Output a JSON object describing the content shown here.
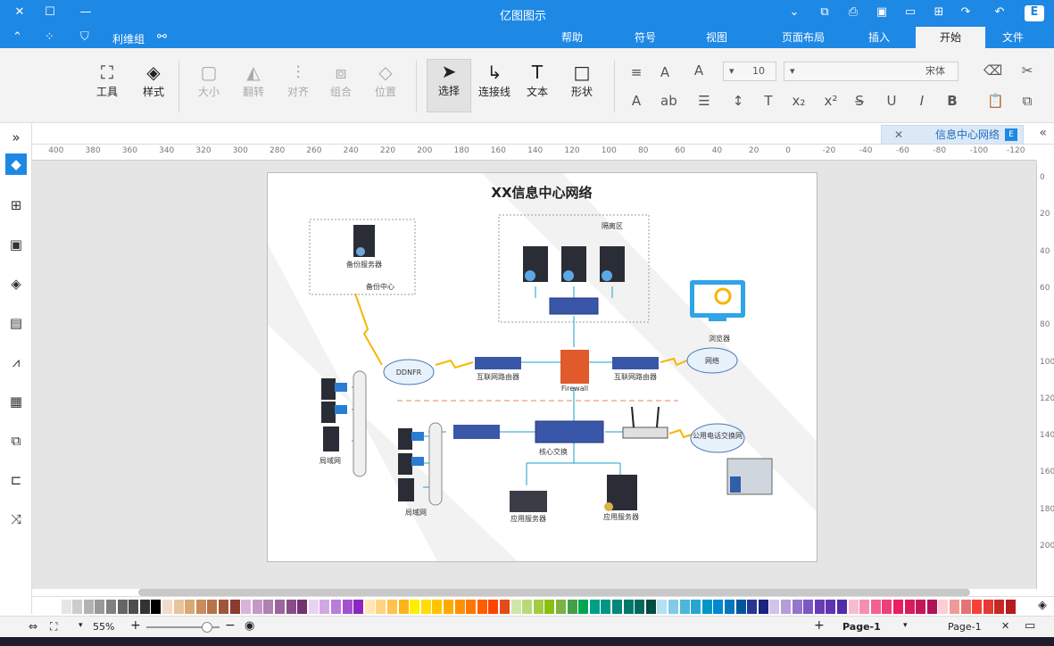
{
  "window": {
    "title": "亿图图示"
  },
  "menu": {
    "tabs": [
      "文件",
      "开始",
      "插入",
      "页面布局",
      "视图",
      "符号",
      "帮助"
    ],
    "active": "开始",
    "quick_items": [
      "利维组"
    ]
  },
  "ribbon": {
    "font_name": "宋体",
    "font_size": "10",
    "tools": [
      {
        "label": "形状",
        "icon": "shape-icon"
      },
      {
        "label": "文本",
        "icon": "text-icon"
      },
      {
        "label": "连接线",
        "icon": "connector-icon"
      },
      {
        "label": "选择",
        "icon": "select-icon"
      },
      {
        "label": "位置",
        "icon": "position-icon"
      },
      {
        "label": "组合",
        "icon": "group-icon"
      },
      {
        "label": "对齐",
        "icon": "align-icon"
      },
      {
        "label": "翻转",
        "icon": "flip-icon"
      },
      {
        "label": "大小",
        "icon": "size-icon"
      },
      {
        "label": "样式",
        "icon": "style-icon"
      },
      {
        "label": "工具",
        "icon": "tool-icon"
      }
    ]
  },
  "document": {
    "tab_title": "信息中心网络"
  },
  "ruler": {
    "h_ticks": [
      "-120",
      "-100",
      "-80",
      "-60",
      "-40",
      "-20",
      "0",
      "20",
      "40",
      "60",
      "80",
      "100",
      "120",
      "140",
      "160",
      "180",
      "200",
      "220",
      "240",
      "260",
      "280",
      "300",
      "320",
      "340",
      "360",
      "380",
      "400"
    ],
    "v_ticks": [
      "0",
      "20",
      "40",
      "60",
      "80",
      "100",
      "120",
      "140",
      "160",
      "180",
      "200"
    ]
  },
  "diagram": {
    "title": "XX信息中心网络",
    "labels": {
      "backup_center": "备份中心",
      "backup_server": "备份服务器",
      "isolation_zone": "隔离区",
      "browser": "浏览器",
      "internet": "网络",
      "ddnfr": "DDNFR",
      "router_left": "互联网路由器",
      "router_right": "互联网路由器",
      "firewall": "Firewall",
      "core_switch": "核心交换",
      "lan1": "局域网",
      "lan2": "局域网",
      "public_net": "公用电话交换网",
      "app_server1": "应用服务器",
      "app_server2": "应用服务器"
    }
  },
  "statusbar": {
    "page_select": "Page-1",
    "page_tab": "Page-1",
    "zoom": "55%"
  },
  "colors": {
    "accent": "#1e88e5",
    "ribbon_bg": "#f3f3f3",
    "canvas_bg": "#e5e5e5"
  },
  "palette": [
    "#ffffff",
    "#e6e6e6",
    "#cccccc",
    "#b3b3b3",
    "#999999",
    "#808080",
    "#666666",
    "#4d4d4d",
    "#333333",
    "#000000",
    "#f2dcc8",
    "#e8c39e",
    "#d9a877",
    "#c98d5b",
    "#b87348",
    "#a0563a",
    "#8b3a2e",
    "#d9b3d9",
    "#c49ac4",
    "#b080b0",
    "#9c669c",
    "#884d88",
    "#733373",
    "#e8d4f2",
    "#d1a8e6",
    "#ba7dd9",
    "#a352cc",
    "#8c26bf",
    "#ffe6b3",
    "#ffd480",
    "#ffc24d",
    "#ffb31a",
    "#ffee00",
    "#ffdd00",
    "#ffc400",
    "#ffaa00",
    "#ff9100",
    "#ff7700",
    "#ff5e00",
    "#ff4400",
    "#e64a19",
    "#cfe6a8",
    "#b8d975",
    "#a1cc42",
    "#8abf0f",
    "#7cb342",
    "#43a047",
    "#00a651",
    "#00a086",
    "#009688",
    "#00897b",
    "#00796b",
    "#00695c",
    "#004d40",
    "#b3e0f2",
    "#80cbe6",
    "#4db6d9",
    "#26a6d1",
    "#0097c7",
    "#0288d1",
    "#0277bd",
    "#01579b",
    "#283593",
    "#1a237e",
    "#d1c4e9",
    "#b39ddb",
    "#9575cd",
    "#7e57c2",
    "#673ab7",
    "#5e35b1",
    "#512da8",
    "#f8bbd0",
    "#f48fb1",
    "#f06292",
    "#ec407a",
    "#e91e63",
    "#d81b60",
    "#c2185b",
    "#ad1457",
    "#ffcdd2",
    "#ef9a9a",
    "#e57373",
    "#f44336",
    "#e53935",
    "#c62828",
    "#b71c1c"
  ]
}
